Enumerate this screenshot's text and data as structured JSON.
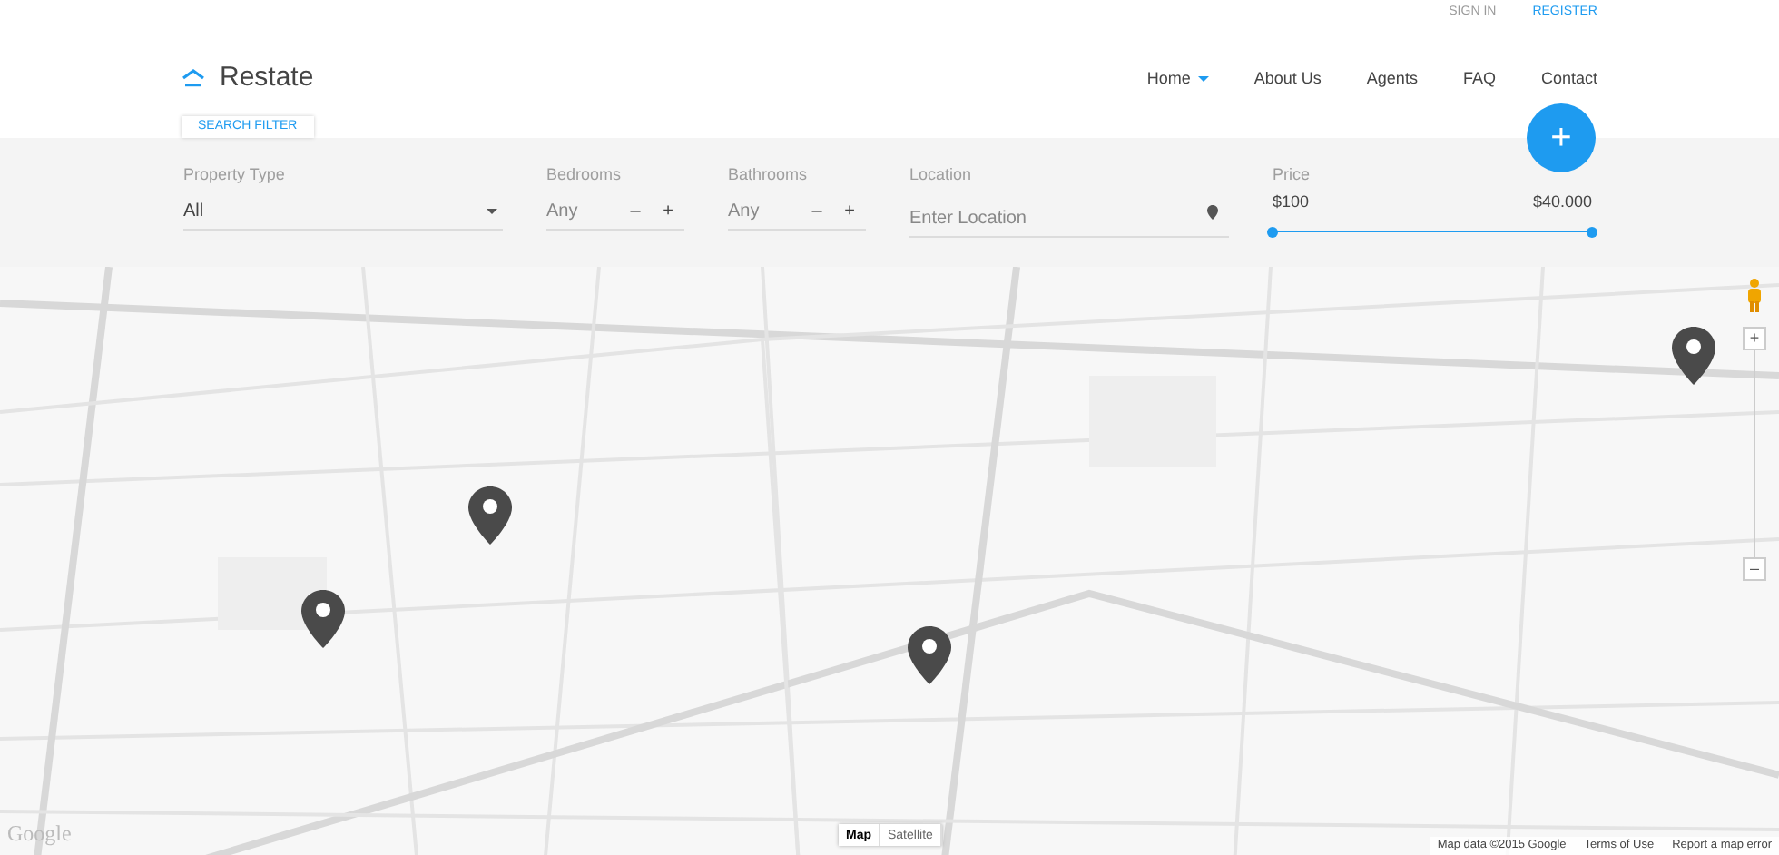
{
  "top_links": [
    {
      "label": "SIGN IN",
      "selected": false
    },
    {
      "label": "REGISTER",
      "selected": true
    }
  ],
  "logo": {
    "text": "Restate"
  },
  "nav": [
    {
      "label": "Home",
      "dropdown": true
    },
    {
      "label": "About Us",
      "dropdown": false
    },
    {
      "label": "Agents",
      "dropdown": false
    },
    {
      "label": "FAQ",
      "dropdown": false
    },
    {
      "label": "Contact",
      "dropdown": false
    }
  ],
  "add_button": {
    "label": "+"
  },
  "filter_tab": "SEARCH FILTER",
  "filters": [
    {
      "kind": "select",
      "label": "Property Type",
      "value": "All"
    },
    {
      "kind": "stepper",
      "label": "Bedrooms",
      "placeholder": "Any",
      "minus": "–",
      "plus": "+"
    },
    {
      "kind": "stepper",
      "label": "Bathrooms",
      "placeholder": "Any",
      "minus": "–",
      "plus": "+"
    },
    {
      "kind": "location",
      "label": "Location",
      "placeholder": "Enter Location"
    },
    {
      "kind": "range",
      "label": "Price",
      "min": "$100",
      "max": "$40.000",
      "level": 1
    }
  ],
  "map": {
    "kind": "picture",
    "pins": [
      {
        "kind": "pin"
      },
      {
        "kind": "pin"
      },
      {
        "kind": "pin"
      },
      {
        "kind": "pin"
      }
    ],
    "type_buttons": [
      {
        "label": "Map",
        "selected": true
      },
      {
        "label": "Satellite",
        "selected": false
      }
    ],
    "zoom_in": "+",
    "zoom_out": "–",
    "logo": "Google",
    "footer": [
      "Map data ©2015 Google",
      "Terms of Use",
      "Report a map error"
    ]
  }
}
